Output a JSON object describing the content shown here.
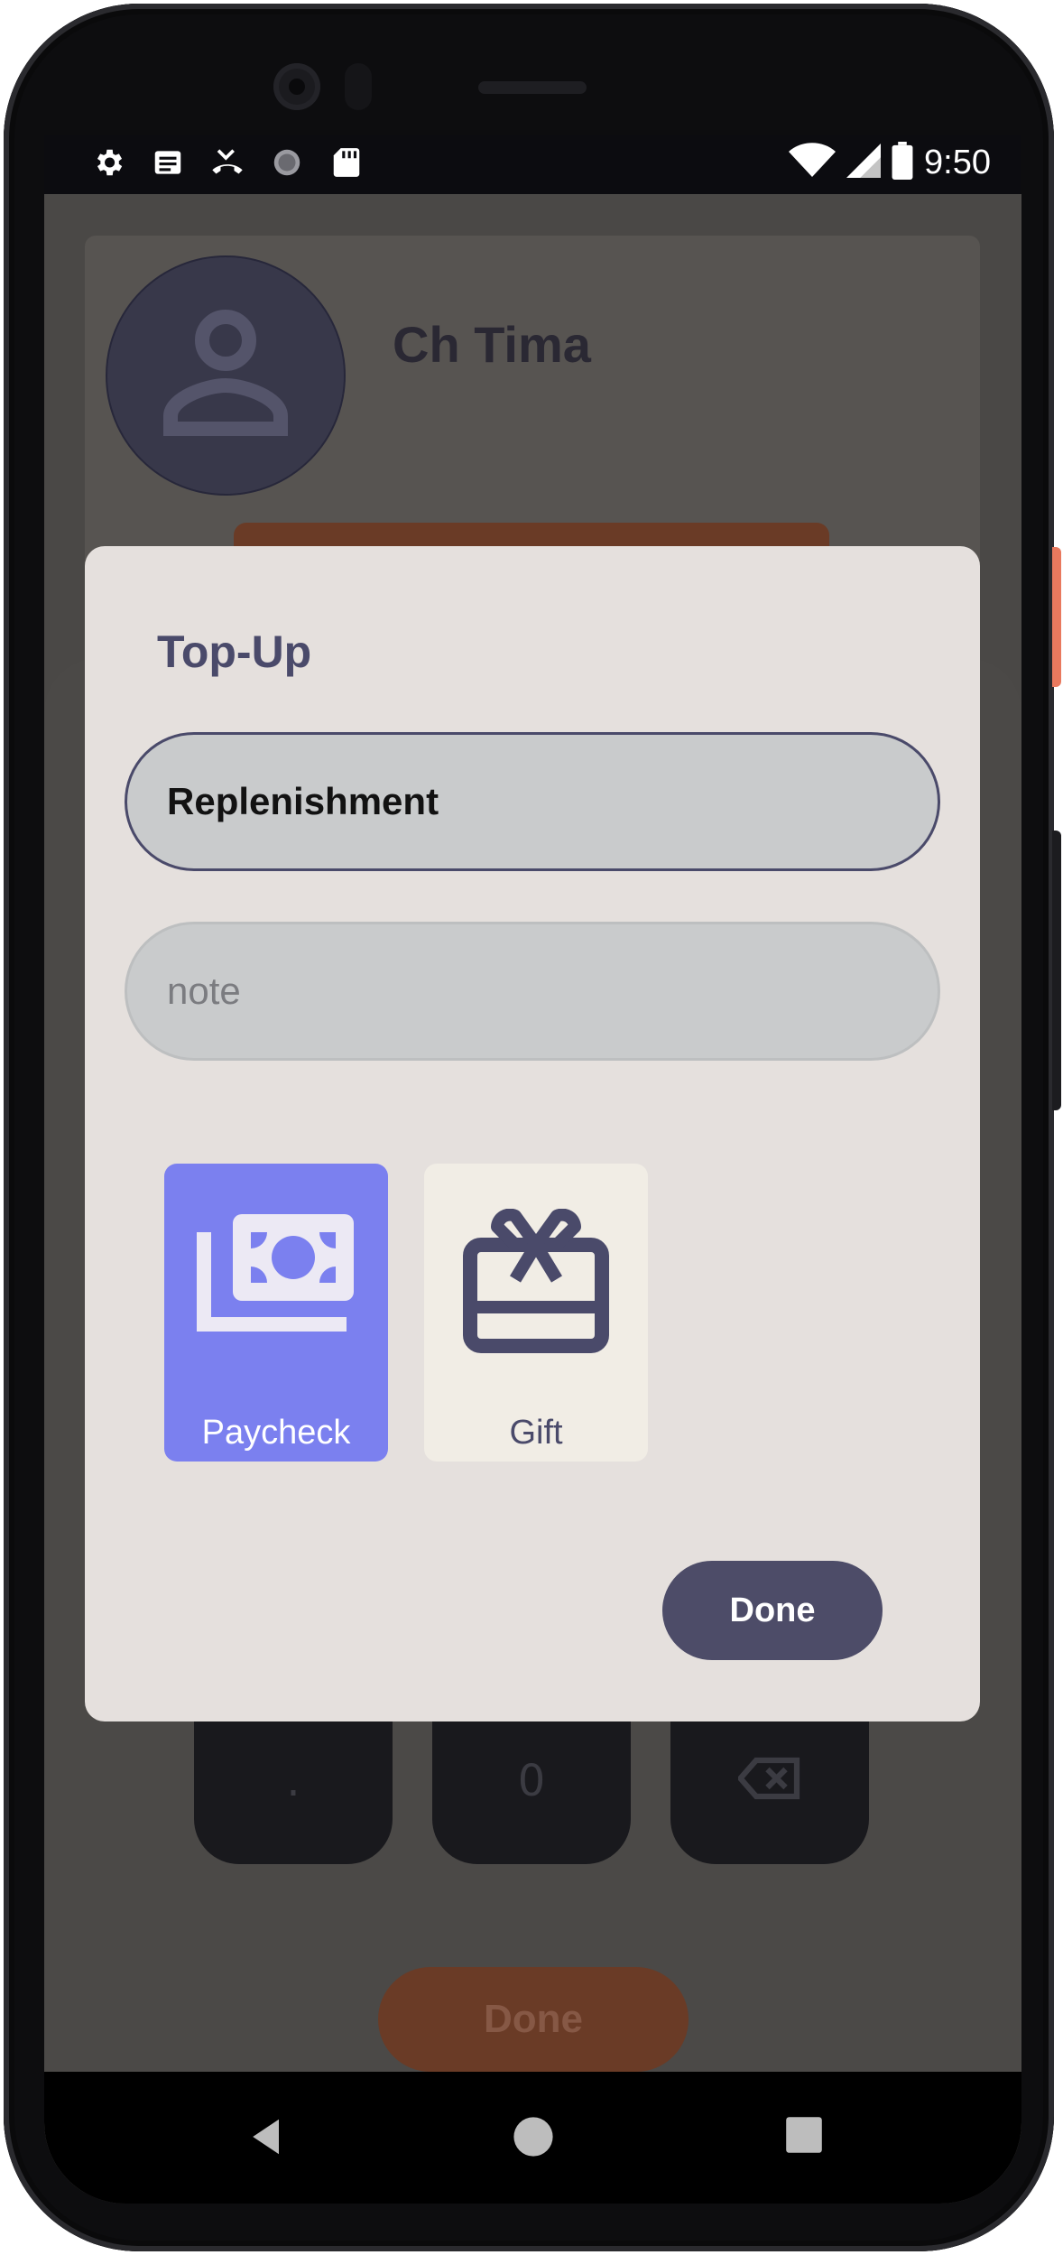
{
  "status_bar": {
    "time": "9:50",
    "icons_left": [
      "gear-icon",
      "notes-icon",
      "missed-call-icon",
      "sync-icon",
      "sd-card-icon"
    ],
    "icons_right": [
      "wifi-icon",
      "signal-icon",
      "battery-icon"
    ]
  },
  "background": {
    "user_name": "Ch Tima",
    "keypad": [
      ".",
      "0",
      "backspace"
    ],
    "done_label": "Done"
  },
  "dialog": {
    "title": "Top-Up",
    "amount_value": "Replenishment",
    "note_placeholder": "note",
    "categories": [
      {
        "label": "Paycheck",
        "icon": "money-icon",
        "selected": true
      },
      {
        "label": "Gift",
        "icon": "gift-card-icon",
        "selected": false
      }
    ],
    "done_label": "Done"
  },
  "nav": [
    "back-icon",
    "home-icon",
    "recents-icon"
  ],
  "colors": {
    "accent": "#7b80ef",
    "primary": "#4d4c68",
    "dialog_bg": "#e5e0dd",
    "scrim": "#4a4846"
  }
}
